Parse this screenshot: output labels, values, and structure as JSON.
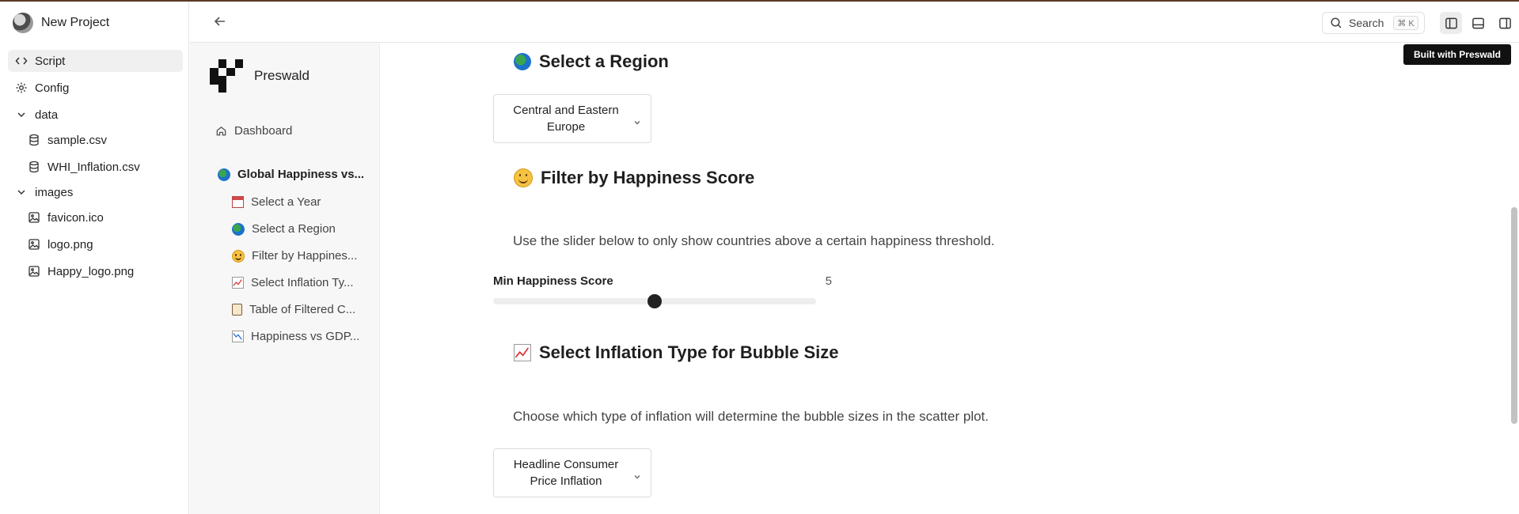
{
  "project": {
    "name": "New Project"
  },
  "filetree": {
    "script_label": "Script",
    "config_label": "Config",
    "data_folder": "data",
    "data_files": [
      "sample.csv",
      "WHI_Inflation.csv"
    ],
    "images_folder": "images",
    "image_files": [
      "favicon.ico",
      "logo.png",
      "Happy_logo.png"
    ]
  },
  "topbar": {
    "search_label": "Search",
    "shortcut": "⌘ K"
  },
  "badge": "Built with Preswald",
  "app": {
    "brand": "Preswald",
    "dashboard": "Dashboard",
    "group": "Global Happiness vs...",
    "nav": [
      "Select a Year",
      "Select a Region",
      "Filter by Happines...",
      "Select Inflation Ty...",
      "Table of Filtered C...",
      "Happiness vs GDP..."
    ]
  },
  "main": {
    "region_heading": "Select a Region",
    "region_value": "Central and Eastern Europe",
    "happiness_heading": "Filter by Happiness Score",
    "happiness_text": "Use the slider below to only show countries above a certain happiness threshold.",
    "slider_label": "Min Happiness Score",
    "slider_value": 5,
    "slider_min": 0,
    "slider_max": 10,
    "inflation_heading": "Select Inflation Type for Bubble Size",
    "inflation_text": "Choose which type of inflation will determine the bubble sizes in the scatter plot.",
    "inflation_value": "Headline Consumer Price Inflation"
  }
}
